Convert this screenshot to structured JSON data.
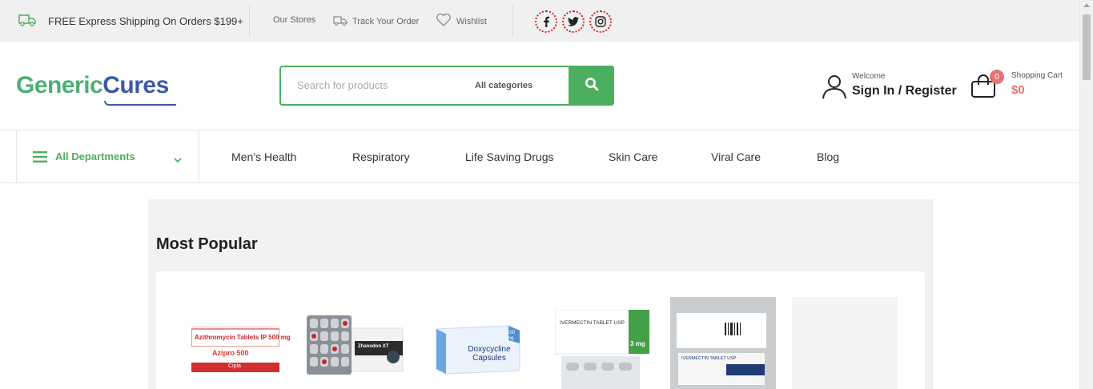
{
  "topbar": {
    "shipping_text": "FREE Express Shipping On Orders $199+",
    "stores_label": "Our Stores",
    "track_label": "Track Your Order",
    "wishlist_label": "Wishlist",
    "social": [
      "f",
      "t",
      "ig"
    ]
  },
  "header": {
    "logo_part1": "Generic",
    "logo_part2": "Cures",
    "search_placeholder": "Search for products",
    "search_category": "All categories",
    "welcome": "Welcome",
    "sign_in": "Sign In / Register",
    "cart_count": "0",
    "cart_label": "Shopping Cart",
    "cart_total": "$0"
  },
  "nav": {
    "departments_label": "All Departments",
    "items": [
      "Men’s Health",
      "Respiratory",
      "Life Saving Drugs",
      "Skin Care",
      "Viral Care",
      "Blog"
    ]
  },
  "main": {
    "section_title": "Most Popular",
    "products": [
      {
        "box_text": "Azithromycin Tablets IP 500 mg",
        "brand": "Azipro 500",
        "maker": "Cipla"
      },
      {
        "box_text": "Zhanodon XT",
        "brand": "",
        "maker": ""
      },
      {
        "box_text": "Doxycycline Capsules",
        "brand": "100 mg",
        "maker": ""
      },
      {
        "box_text": "IVERMECTIN TABLET USP",
        "brand": "3 mg",
        "maker": ""
      },
      {
        "box_text": "IVERMECTIN TABLET USP",
        "brand": "",
        "maker": ""
      },
      {
        "box_text": "",
        "brand": "",
        "maker": ""
      }
    ]
  },
  "colors": {
    "green": "#4caf5f",
    "blue": "#3d5aa8",
    "badge": "#e57373"
  }
}
